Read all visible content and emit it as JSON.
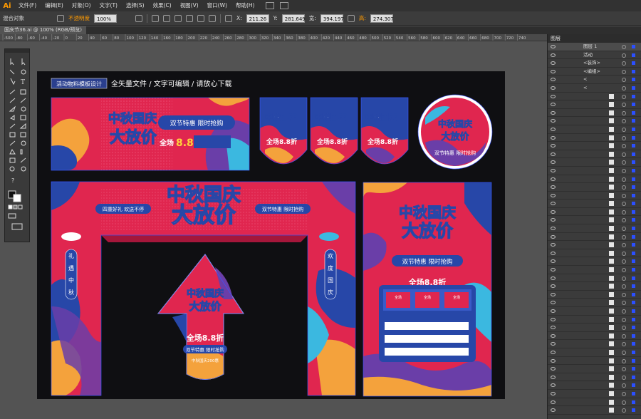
{
  "app": {
    "logo": "Ai"
  },
  "menu": [
    "文件(F)",
    "编辑(E)",
    "对象(O)",
    "文字(T)",
    "选择(S)",
    "效果(C)",
    "视图(V)",
    "窗口(W)",
    "帮助(H)"
  ],
  "control": {
    "selection_label": "混合对象",
    "opacity_label": "不透明度",
    "opacity_value": "100%",
    "x_value": "211.26",
    "y_value": "281.649",
    "w_value": "394.197",
    "h_value": "274.307",
    "x_label": "X:",
    "y_label": "Y:",
    "w_label": "宽:",
    "h_label": "高:"
  },
  "document": {
    "tab_title": "国庆节36.ai @ 100% (RGB/预览)"
  },
  "ruler": {
    "labels": [
      "-500",
      "-80",
      "-60",
      "-40",
      "-20",
      "0",
      "20",
      "40",
      "60",
      "80",
      "100",
      "120",
      "140",
      "160",
      "180",
      "200",
      "220",
      "240",
      "260",
      "280",
      "300",
      "320",
      "340",
      "360",
      "380",
      "400",
      "420",
      "440",
      "460",
      "480",
      "500",
      "520",
      "540",
      "560",
      "580",
      "600",
      "620",
      "640",
      "660",
      "680",
      "700",
      "720",
      "740"
    ]
  },
  "canvas": {
    "header_badge": "活动物料模板设计",
    "header_text": "全矢量文件 / 文字可编辑 / 请放心下载",
    "title_line1": "中秋国庆",
    "title_line2": "大放价",
    "title_inline": "中秋国庆大放价",
    "promo_tag": "双节特惠 限时抢购",
    "discount_text": "全场8.8折",
    "discount_prefix": "全场",
    "discount_number": "8.8",
    "discount_suffix": "折",
    "arch_left_badge": "四重好礼 欢送不停",
    "arch_right_badge": "双节特惠 限时抢购",
    "pillar_left": [
      "礼",
      "遇",
      "中",
      "秋"
    ],
    "pillar_right": [
      "欢",
      "度",
      "国",
      "庆"
    ],
    "coupon_labels": [
      "全场",
      "全场",
      "全场"
    ],
    "arrow_footer": "中秋国庆200惠"
  },
  "layers": {
    "tab": "图层",
    "rows": [
      {
        "name": "图层 1",
        "expanded": true
      },
      {
        "name": "活动",
        "expanded": false
      },
      {
        "name": "<装饰>",
        "expanded": false
      },
      {
        "name": "<编组>",
        "expanded": true
      },
      {
        "name": "<",
        "expanded": false
      },
      {
        "name": "<",
        "expanded": false
      }
    ]
  },
  "colors": {
    "brand_red": "#e0264f",
    "deep_blue": "#2747a8",
    "orange": "#f4a23c",
    "cyan": "#3bb8e0",
    "purple": "#6a3ea8",
    "selection": "#3a57ff"
  }
}
